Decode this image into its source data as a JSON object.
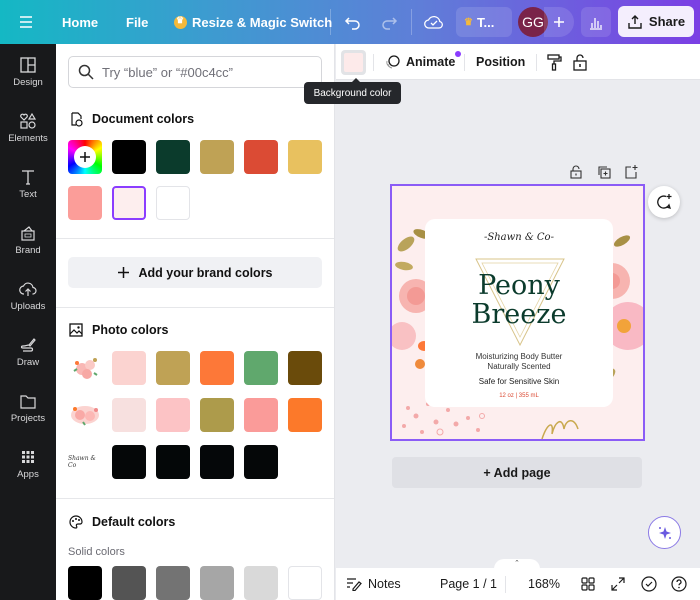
{
  "topbar": {
    "menu_icon": "hamburger-menu-icon",
    "home": "Home",
    "file": "File",
    "resize": "Resize & Magic Switch",
    "undo_icon": "undo-icon",
    "redo_icon": "redo-icon",
    "cloud_icon": "cloud-saved-icon",
    "team_label": "T...",
    "avatar_initials": "GG",
    "add_icon": "plus-icon",
    "insights_icon": "bar-chart-icon",
    "share": "Share",
    "gradient_start": "#14b8c4",
    "gradient_end": "#7b3fe4"
  },
  "rail": {
    "items": [
      {
        "label": "Design",
        "icon": "layout-icon"
      },
      {
        "label": "Elements",
        "icon": "shapes-icon"
      },
      {
        "label": "Text",
        "icon": "text-icon"
      },
      {
        "label": "Brand",
        "icon": "brand-kit-icon"
      },
      {
        "label": "Uploads",
        "icon": "cloud-upload-icon"
      },
      {
        "label": "Draw",
        "icon": "draw-icon"
      },
      {
        "label": "Projects",
        "icon": "folder-icon"
      },
      {
        "label": "Apps",
        "icon": "apps-grid-icon"
      }
    ]
  },
  "panel": {
    "search_placeholder": "Try “blue” or “#00c4cc”",
    "document_colors": {
      "title": "Document colors",
      "swatches": [
        "#000000",
        "#0b3b2c",
        "#bfa255",
        "#db4b34",
        "#e8c15f",
        "#fb9d99",
        "#fdeeee",
        "#ffffff"
      ],
      "selected": "#fdeeee"
    },
    "brand_button": "Add your brand colors",
    "photo_colors": {
      "title": "Photo colors",
      "rows": [
        {
          "thumb": "floral-bouquet-1",
          "swatches": [
            "#fbd3d0",
            "#bfa255",
            "#fd7838",
            "#60a86d",
            "#6a4b0b"
          ]
        },
        {
          "thumb": "floral-bouquet-2",
          "swatches": [
            "#f7e0df",
            "#fcc3c5",
            "#ad9b4b",
            "#fa9b99",
            "#fc792a"
          ]
        },
        {
          "thumb": "signature-logo",
          "swatches": [
            "#050708",
            "#040708",
            "#050709",
            "#050708"
          ]
        }
      ]
    },
    "default_colors": {
      "title": "Default colors",
      "subtitle": "Solid colors",
      "swatches": [
        "#000000",
        "#545454",
        "#737373",
        "#a6a6a6",
        "#d9d9d9",
        "#ffffff"
      ]
    }
  },
  "context_bar": {
    "bg_color": "#fdeaea",
    "animate": "Animate",
    "position": "Position",
    "paint_roller_icon": "copy-style-icon",
    "lock_icon": "lock-icon",
    "tooltip": "Background color"
  },
  "design": {
    "brand": "-Shawn & Co-",
    "title_line1": "Peony",
    "title_line2": "Breeze",
    "line1": "Moisturizing Body Butter",
    "line2": "Naturally Scented",
    "line3": "Safe for Sensitive Skin",
    "size": "12 oz | 355 mL",
    "bg": "#fdeeee",
    "title_color": "#0b3b2c",
    "size_color": "#db4b34"
  },
  "canvas": {
    "add_page": "+ Add page"
  },
  "bottombar": {
    "notes": "Notes",
    "page": "Page 1 / 1",
    "zoom": "168%"
  }
}
